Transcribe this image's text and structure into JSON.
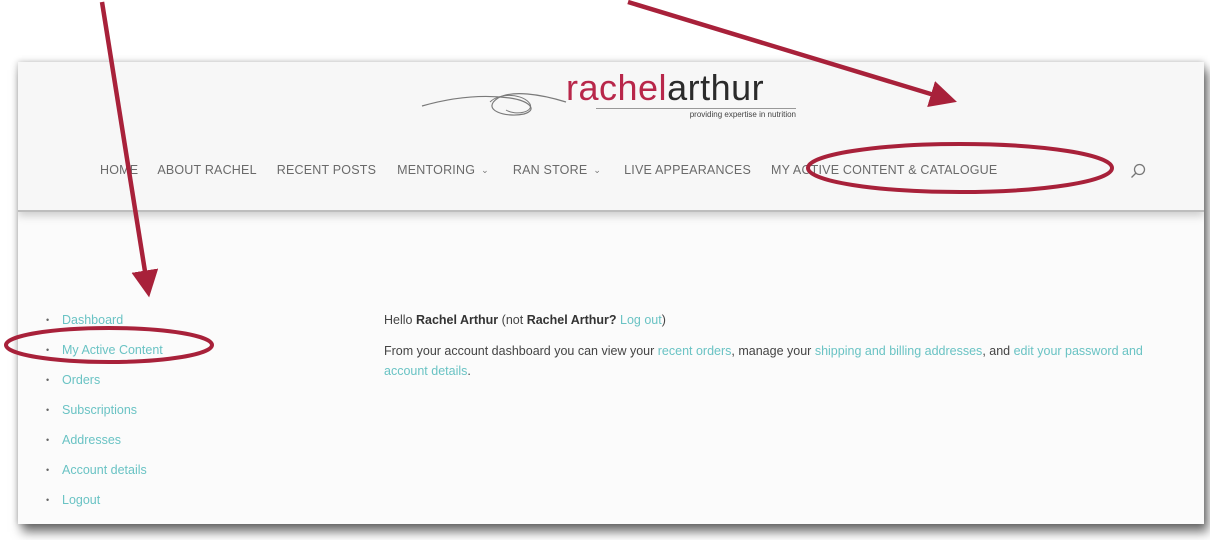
{
  "site": {
    "logo_part1": "rachel",
    "logo_part2": "arthur",
    "tagline": "providing expertise in nutrition"
  },
  "nav": {
    "items": [
      {
        "label": "HOME"
      },
      {
        "label": "ABOUT RACHEL"
      },
      {
        "label": "RECENT POSTS"
      },
      {
        "label": "MENTORING",
        "dropdown": true
      },
      {
        "label": "RAN STORE",
        "dropdown": true
      },
      {
        "label": "LIVE APPEARANCES"
      },
      {
        "label": "MY ACTIVE CONTENT & CATALOGUE"
      }
    ],
    "search_icon": "search-icon"
  },
  "sidebar": {
    "items": [
      {
        "label": "Dashboard"
      },
      {
        "label": "My Active Content"
      },
      {
        "label": "Orders"
      },
      {
        "label": "Subscriptions"
      },
      {
        "label": "Addresses"
      },
      {
        "label": "Account details"
      },
      {
        "label": "Logout"
      }
    ]
  },
  "content": {
    "hello": "Hello",
    "user_name": "Rachel Arthur",
    "not_prefix": "(not",
    "not_name": "Rachel Arthur?",
    "logout_link": "Log out",
    "close_paren": ")",
    "dash_text1": "From your account dashboard you can view your",
    "recent_orders_link": "recent orders",
    "dash_text2": ", manage your",
    "addresses_link": "shipping and billing addresses",
    "dash_text3": ", and",
    "account_link": "edit your password and account details",
    "dash_text4": "."
  },
  "colors": {
    "annotation": "#a8213a",
    "link": "#6ac3c4",
    "brand": "#b8274a"
  }
}
